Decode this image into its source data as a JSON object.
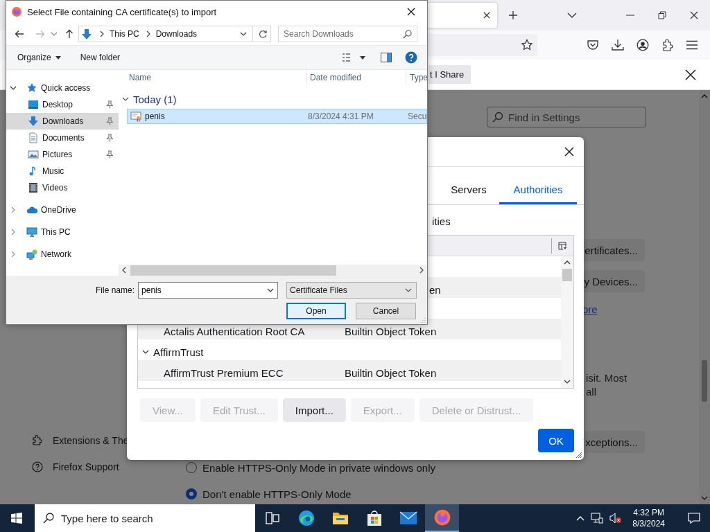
{
  "browser": {
    "notification": {
      "button": "t I Share"
    },
    "settings": {
      "search": {
        "placeholder": "Find in Settings"
      },
      "buttons": [
        {
          "label": "ertificates..."
        },
        {
          "label": "y Devices..."
        }
      ],
      "link": "ore",
      "text_lines": [
        "isit. Most",
        "all"
      ],
      "exceptions_button": "xceptions...",
      "sidebar": [
        {
          "kind": "extensions",
          "label": "Extensions & The"
        },
        {
          "kind": "help",
          "label": "Firefox Support"
        }
      ],
      "radios": [
        {
          "label": "Enable HTTPS-Only Mode in private windows only",
          "selected": false
        },
        {
          "label": "Don't enable HTTPS-Only Mode",
          "selected": true
        }
      ]
    }
  },
  "certificate_manager": {
    "tabs": [
      {
        "label": "Servers",
        "selected": false
      },
      {
        "label": "Authorities",
        "selected": true
      }
    ],
    "heading": "ities",
    "tree": {
      "rows": [
        {
          "kind": "blank"
        },
        {
          "kind": "covered",
          "column_2": "en"
        },
        {
          "kind": "blank"
        },
        {
          "kind": "cert",
          "column_1": "Actalis Authentication Root CA",
          "column_2": "Builtin Object Token"
        },
        {
          "kind": "group",
          "column_1": "AffirmTrust",
          "expanded": true
        },
        {
          "kind": "cert",
          "column_1": "AffirmTrust Premium ECC",
          "column_2": "Builtin Object Token"
        }
      ]
    },
    "buttons": [
      {
        "label": "View...",
        "disabled": true
      },
      {
        "label": "Edit Trust...",
        "disabled": true
      },
      {
        "label": "Import...",
        "disabled": false
      },
      {
        "label": "Export...",
        "disabled": true
      },
      {
        "label": "Delete or Distrust...",
        "disabled": true
      }
    ],
    "ok": "OK"
  },
  "file_dialog": {
    "title": "Select File containing CA certificate(s) to import",
    "path": [
      "This PC",
      "Downloads"
    ],
    "search": {
      "placeholder": "Search Downloads"
    },
    "organize": "Organize",
    "new_folder": "New folder",
    "nav": [
      {
        "kind": "star",
        "label": "Quick access",
        "expanded": true,
        "selected": false,
        "children": [
          {
            "kind": "desktop",
            "label": "Desktop",
            "pinned": true,
            "selected": false
          },
          {
            "kind": "download",
            "label": "Downloads",
            "pinned": true,
            "selected": true
          },
          {
            "kind": "document",
            "label": "Documents",
            "pinned": true,
            "selected": false
          },
          {
            "kind": "picture",
            "label": "Pictures",
            "pinned": true,
            "selected": false
          },
          {
            "kind": "music",
            "label": "Music",
            "pinned": false,
            "selected": false
          },
          {
            "kind": "video",
            "label": "Videos",
            "pinned": false,
            "selected": false
          }
        ]
      },
      {
        "kind": "cloud",
        "label": "OneDrive",
        "expanded": false,
        "selected": false
      },
      {
        "kind": "pc",
        "label": "This PC",
        "expanded": false,
        "selected": false
      },
      {
        "kind": "network",
        "label": "Network",
        "expanded": false,
        "selected": false
      }
    ],
    "columns": [
      "Name",
      "Date modified",
      "Type"
    ],
    "groups": [
      {
        "label": "Today (1)",
        "expanded": true,
        "files": [
          {
            "name": "penis",
            "date": "8/3/2024 4:31 PM",
            "type": "Secu",
            "selected": true
          }
        ]
      }
    ],
    "file_name": {
      "label": "File name:",
      "value": "penis"
    },
    "file_type": "Certificate Files",
    "buttons": [
      {
        "label": "Open",
        "default": true
      },
      {
        "label": "Cancel",
        "default": false
      }
    ]
  },
  "taskbar": {
    "search": {
      "placeholder": "Type here to search"
    },
    "apps": [
      {
        "kind": "taskview",
        "active": false
      },
      {
        "kind": "edge",
        "active": false
      },
      {
        "kind": "explorer",
        "active": false
      },
      {
        "kind": "store",
        "active": false
      },
      {
        "kind": "mail",
        "active": false
      },
      {
        "kind": "firefox",
        "active": true
      }
    ],
    "clock": {
      "time": "4:32 PM",
      "date": "8/3/2024"
    }
  }
}
